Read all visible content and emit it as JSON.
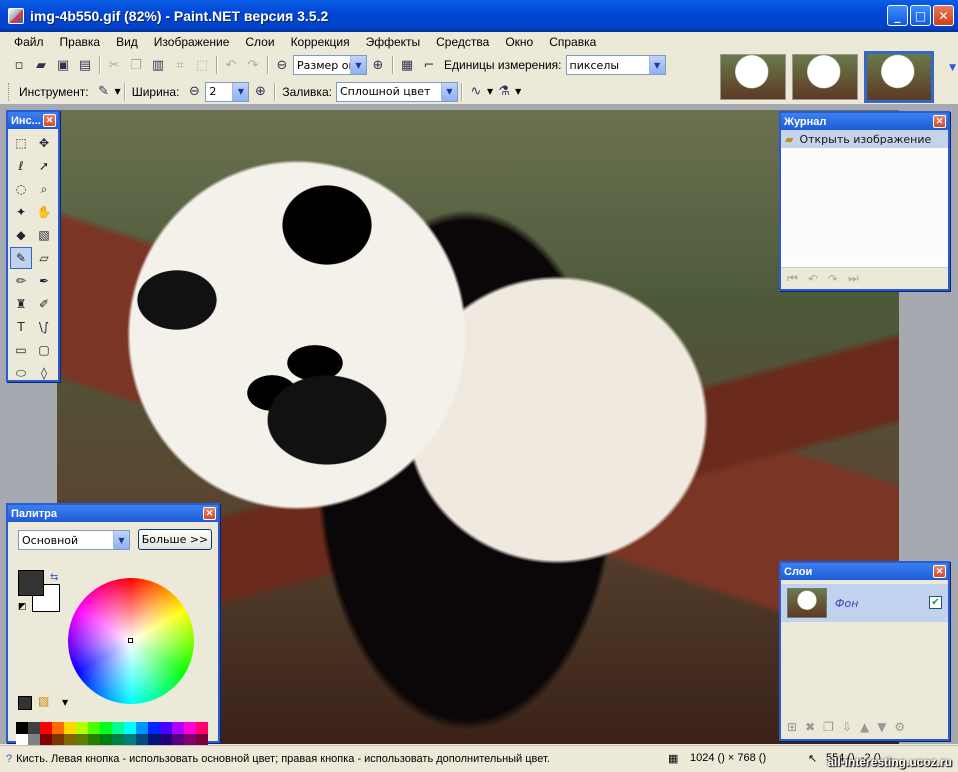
{
  "window": {
    "title": "img-4b550.gif (82%) - Paint.NET версия 3.5.2",
    "minimize": "_",
    "maximize": "□",
    "close": "✕"
  },
  "menu": [
    "Файл",
    "Правка",
    "Вид",
    "Изображение",
    "Слои",
    "Коррекция",
    "Эффекты",
    "Средства",
    "Окно",
    "Справка"
  ],
  "toolbar": {
    "zoom_value": "Размер окн",
    "units_label": "Единицы измерения:",
    "units_value": "пикселы",
    "tool_label": "Инструмент:",
    "width_label": "Ширина:",
    "width_value": "2",
    "fill_label": "Заливка:",
    "fill_value": "Сплошной цвет"
  },
  "tools": {
    "title": "Инс..."
  },
  "history": {
    "title": "Журнал",
    "items": [
      "Открыть изображение"
    ]
  },
  "palette": {
    "title": "Палитра",
    "mode": "Основной",
    "more": "Больше >>",
    "primary_color": "#333333",
    "secondary_color": "#ffffff"
  },
  "layers": {
    "title": "Слои",
    "items": [
      {
        "name": "Фон",
        "visible": true
      }
    ]
  },
  "status": {
    "hint": "Кисть. Левая кнопка - использовать основной цвет; правая кнопка - использовать дополнительный цвет.",
    "image_size": "1024 () × 768 ()",
    "cursor_pos": "554 (), -2 ()",
    "watermark": "all-interesting.ucoz.ru"
  },
  "colors": {
    "accent": "#2a5bd7",
    "chrome": "#ece9d8",
    "selection": "#c1d2ee"
  }
}
